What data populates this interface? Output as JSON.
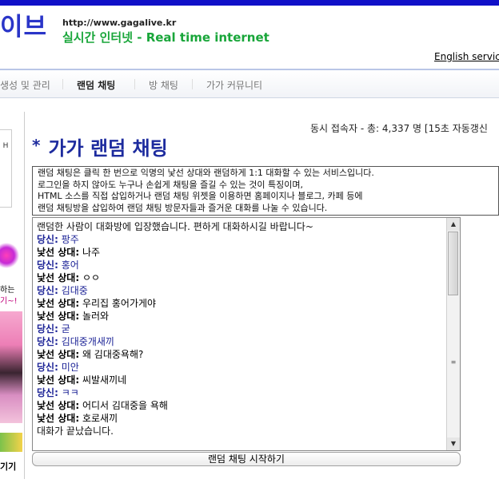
{
  "header": {
    "logo": "이브",
    "url": "http://www.gagalive.kr",
    "tagline": "실시간 인터넷 - Real time internet",
    "english_link": "English servic"
  },
  "nav": {
    "items": [
      "생성 및 관리",
      "랜덤 채팅",
      "방 채팅",
      "가가 커뮤니티"
    ],
    "active_index": 1
  },
  "left": {
    "box_text": "H",
    "text1": "하는",
    "text2": "기~!",
    "text3": "기기"
  },
  "status": {
    "online": "동시 접속자 - 총: 4,337 명 [15초 자동갱신"
  },
  "page": {
    "title_star": "*",
    "title": "가가 랜덤 채팅"
  },
  "description": [
    "랜덤 채팅은 클릭 한 번으로 익명의 낯선 상대와 랜덤하게 1:1 대화할 수 있는 서비스입니다.",
    "로그인을 하지 않아도 누구나 손쉽게 채팅을 즐길 수 있는 것이 특징이며,",
    "HTML 소스를 직접 삽입하거나 랜덤 채팅 위젯을 이용하면 홈페이지나 블로그, 카페 등에",
    "랜덤 채팅방을 삽입하여 랜덤 채팅 방문자들과 즐거운 대화를 나눌 수 있습니다."
  ],
  "chat": {
    "system_start": "랜덤한 사람이 대화방에 입장했습니다. 편하게 대화하시길 바랍니다~",
    "messages": [
      {
        "speaker": "당신:",
        "text": " 팡주",
        "who": "you"
      },
      {
        "speaker": "낯선 상대:",
        "text": " 나주",
        "who": "stranger"
      },
      {
        "speaker": "당신:",
        "text": " 홍어",
        "who": "you"
      },
      {
        "speaker": "낯선 상대:",
        "text": " ㅇㅇ",
        "who": "stranger"
      },
      {
        "speaker": "당신:",
        "text": " 김대중",
        "who": "you"
      },
      {
        "speaker": "낯선 상대:",
        "text": " 우리집 홍어가게야",
        "who": "stranger"
      },
      {
        "speaker": "낯선 상대:",
        "text": " 놀러와",
        "who": "stranger"
      },
      {
        "speaker": "당신:",
        "text": " 굳",
        "who": "you"
      },
      {
        "speaker": "당신:",
        "text": " 김대중개새끼",
        "who": "you"
      },
      {
        "speaker": "낯선 상대:",
        "text": " 왜 김대중욕해?",
        "who": "stranger"
      },
      {
        "speaker": "당신:",
        "text": " 미안",
        "who": "you"
      },
      {
        "speaker": "낯선 상대:",
        "text": " 씨발새끼네",
        "who": "stranger"
      },
      {
        "speaker": "당신:",
        "text": " ㅋㅋ",
        "who": "you"
      },
      {
        "speaker": "낯선 상대:",
        "text": " 어디서 김대중을 욕해",
        "who": "stranger"
      },
      {
        "speaker": "낯선 상대:",
        "text": " 호로새끼",
        "who": "stranger"
      }
    ],
    "system_end": "대화가 끝났습니다.",
    "scroll_up": "▲",
    "scroll_down": "▼",
    "scroll_grip": "≡"
  },
  "actions": {
    "start_button": "랜덤 채팅 시작하기"
  },
  "colors": {
    "brand_blue": "#1d2b9e",
    "tagline_green": "#19a63a",
    "top_bar": "#1010c8"
  }
}
